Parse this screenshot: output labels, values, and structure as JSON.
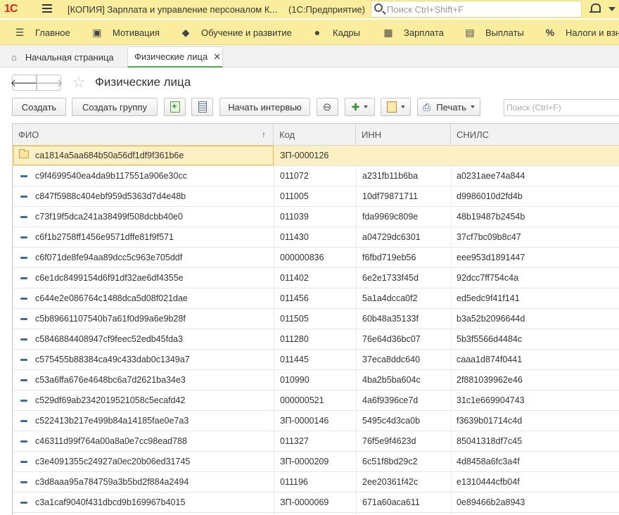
{
  "titlebar": {
    "logo": "1С",
    "title": "[КОПИЯ] Зарплата и управление персоналом К...",
    "subtitle": "(1С:Предприятие)",
    "search_placeholder": "Поиск Ctrl+Shift+F"
  },
  "sections": [
    {
      "label": "Главное",
      "icon": "menu-icon"
    },
    {
      "label": "Мотивация",
      "icon": "gift-icon"
    },
    {
      "label": "Обучение и развитие",
      "icon": "graduation-cap-icon"
    },
    {
      "label": "Кадры",
      "icon": "users-icon"
    },
    {
      "label": "Зарплата",
      "icon": "calculator-icon"
    },
    {
      "label": "Выплаты",
      "icon": "coins-icon"
    },
    {
      "label": "Налоги и взн",
      "icon": "percent-icon"
    }
  ],
  "tabs": {
    "home": "Начальная страница",
    "active": "Физические лица"
  },
  "form": {
    "title": "Физические лица"
  },
  "toolbar": {
    "create": "Создать",
    "create_group": "Создать группу",
    "start_interview": "Начать интервью",
    "print": "Печать",
    "search_placeholder": "Поиск (Ctrl+F)"
  },
  "table": {
    "columns": [
      "ФИО",
      "Код",
      "ИНН",
      "СНИЛС"
    ],
    "rows": [
      {
        "fio": "ca1814a5aa684b50a56df1df9f361b6e",
        "code": "ЗП-0000126",
        "inn": "",
        "snils": "",
        "folder": true
      },
      {
        "fio": "c9f4699540ea4da9b117551a906e30cc",
        "code": "011072",
        "inn": "a231fb11b6ba",
        "snils": "a0231aee74a844"
      },
      {
        "fio": "c847f5988c404ebf959d5363d7d4e48b",
        "code": "011005",
        "inn": "10df79871711",
        "snils": "d9986010d2fd4b"
      },
      {
        "fio": "c73f19f5dca241a38499f508dcbb40e0",
        "code": "011039",
        "inn": "fda9969c809e",
        "snils": "48b19487b2454b"
      },
      {
        "fio": "c6f1b2758ff1456e9571dffe81f9f571",
        "code": "011430",
        "inn": "a04729dc6301",
        "snils": "37cf7bc09b8c47"
      },
      {
        "fio": "c6f071de8fe94aa89dcc5c963e705ddf",
        "code": "000000836",
        "inn": "f6fbd719eb56",
        "snils": "eee953d1891447"
      },
      {
        "fio": "c6e1dc8499154d6f91df32ae6df4355e",
        "code": "011402",
        "inn": "6e2e1733f45d",
        "snils": "92dcc7ff754c4a"
      },
      {
        "fio": "c644e2e086764c1488dca5d08f021dae",
        "code": "011456",
        "inn": "5a1a4dcca0f2",
        "snils": "ed5edc9f41f141"
      },
      {
        "fio": "c5b89661107540b7a61f0d99a6e9b28f",
        "code": "011505",
        "inn": "60b48a35133f",
        "snils": "b3a52b2096644d"
      },
      {
        "fio": "c5846884408947cf9feec52edb45fda3",
        "code": "011280",
        "inn": "76e64d36bc07",
        "snils": "5b3f5566d4484c"
      },
      {
        "fio": "c575455b88384ca49c433dab0c1349a7",
        "code": "011445",
        "inn": "37eca8ddc640",
        "snils": "caaa1d874f0441"
      },
      {
        "fio": "c53a6ffa676e4648bc6a7d2621ba34e3",
        "code": "010990",
        "inn": "4ba2b5ba604c",
        "snils": "2f881039962e46"
      },
      {
        "fio": "c529df69ab2342019521058c5ecafd42",
        "code": "000000521",
        "inn": "4a6f9396ce7d",
        "snils": "31c1e669904743"
      },
      {
        "fio": "c522413b217e499b84a14185fae0e7a3",
        "code": "ЗП-0000146",
        "inn": "5495c4d3ca0b",
        "snils": "f3639b01714c4d"
      },
      {
        "fio": "c46311d99f764a00a8a0e7cc98ead788",
        "code": "011327",
        "inn": "76f5e9f4623d",
        "snils": "85041318df7c45"
      },
      {
        "fio": "c3e4091355c24927a0ec20b06ed31745",
        "code": "ЗП-0000209",
        "inn": "6c51f8bd29c2",
        "snils": "4d8458a6fc3a4f"
      },
      {
        "fio": "c3d8aaa95a784759a3b5bd2f884a2494",
        "code": "011196",
        "inn": "2ee20361f42c",
        "snils": "e1310444cfb04f"
      },
      {
        "fio": "c3a1caf9040f431dbcd9b169967b4015",
        "code": "ЗП-0000069",
        "inn": "671a60aca611",
        "snils": "0e89466b2a8943"
      }
    ]
  }
}
